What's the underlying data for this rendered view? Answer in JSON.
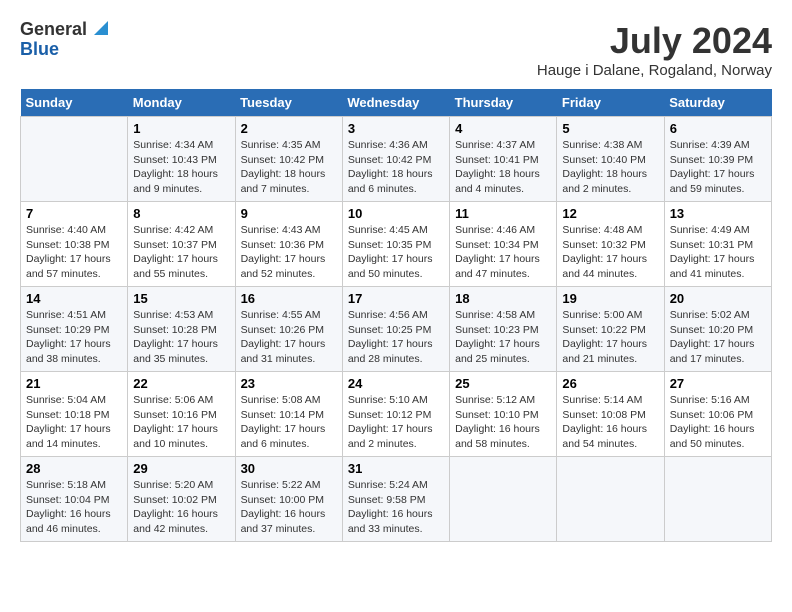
{
  "header": {
    "logo_general": "General",
    "logo_blue": "Blue",
    "title": "July 2024",
    "location": "Hauge i Dalane, Rogaland, Norway"
  },
  "calendar": {
    "days_of_week": [
      "Sunday",
      "Monday",
      "Tuesday",
      "Wednesday",
      "Thursday",
      "Friday",
      "Saturday"
    ],
    "weeks": [
      [
        {
          "day": "",
          "sunrise": "",
          "sunset": "",
          "daylight": ""
        },
        {
          "day": "1",
          "sunrise": "Sunrise: 4:34 AM",
          "sunset": "Sunset: 10:43 PM",
          "daylight": "Daylight: 18 hours and 9 minutes."
        },
        {
          "day": "2",
          "sunrise": "Sunrise: 4:35 AM",
          "sunset": "Sunset: 10:42 PM",
          "daylight": "Daylight: 18 hours and 7 minutes."
        },
        {
          "day": "3",
          "sunrise": "Sunrise: 4:36 AM",
          "sunset": "Sunset: 10:42 PM",
          "daylight": "Daylight: 18 hours and 6 minutes."
        },
        {
          "day": "4",
          "sunrise": "Sunrise: 4:37 AM",
          "sunset": "Sunset: 10:41 PM",
          "daylight": "Daylight: 18 hours and 4 minutes."
        },
        {
          "day": "5",
          "sunrise": "Sunrise: 4:38 AM",
          "sunset": "Sunset: 10:40 PM",
          "daylight": "Daylight: 18 hours and 2 minutes."
        },
        {
          "day": "6",
          "sunrise": "Sunrise: 4:39 AM",
          "sunset": "Sunset: 10:39 PM",
          "daylight": "Daylight: 17 hours and 59 minutes."
        }
      ],
      [
        {
          "day": "7",
          "sunrise": "Sunrise: 4:40 AM",
          "sunset": "Sunset: 10:38 PM",
          "daylight": "Daylight: 17 hours and 57 minutes."
        },
        {
          "day": "8",
          "sunrise": "Sunrise: 4:42 AM",
          "sunset": "Sunset: 10:37 PM",
          "daylight": "Daylight: 17 hours and 55 minutes."
        },
        {
          "day": "9",
          "sunrise": "Sunrise: 4:43 AM",
          "sunset": "Sunset: 10:36 PM",
          "daylight": "Daylight: 17 hours and 52 minutes."
        },
        {
          "day": "10",
          "sunrise": "Sunrise: 4:45 AM",
          "sunset": "Sunset: 10:35 PM",
          "daylight": "Daylight: 17 hours and 50 minutes."
        },
        {
          "day": "11",
          "sunrise": "Sunrise: 4:46 AM",
          "sunset": "Sunset: 10:34 PM",
          "daylight": "Daylight: 17 hours and 47 minutes."
        },
        {
          "day": "12",
          "sunrise": "Sunrise: 4:48 AM",
          "sunset": "Sunset: 10:32 PM",
          "daylight": "Daylight: 17 hours and 44 minutes."
        },
        {
          "day": "13",
          "sunrise": "Sunrise: 4:49 AM",
          "sunset": "Sunset: 10:31 PM",
          "daylight": "Daylight: 17 hours and 41 minutes."
        }
      ],
      [
        {
          "day": "14",
          "sunrise": "Sunrise: 4:51 AM",
          "sunset": "Sunset: 10:29 PM",
          "daylight": "Daylight: 17 hours and 38 minutes."
        },
        {
          "day": "15",
          "sunrise": "Sunrise: 4:53 AM",
          "sunset": "Sunset: 10:28 PM",
          "daylight": "Daylight: 17 hours and 35 minutes."
        },
        {
          "day": "16",
          "sunrise": "Sunrise: 4:55 AM",
          "sunset": "Sunset: 10:26 PM",
          "daylight": "Daylight: 17 hours and 31 minutes."
        },
        {
          "day": "17",
          "sunrise": "Sunrise: 4:56 AM",
          "sunset": "Sunset: 10:25 PM",
          "daylight": "Daylight: 17 hours and 28 minutes."
        },
        {
          "day": "18",
          "sunrise": "Sunrise: 4:58 AM",
          "sunset": "Sunset: 10:23 PM",
          "daylight": "Daylight: 17 hours and 25 minutes."
        },
        {
          "day": "19",
          "sunrise": "Sunrise: 5:00 AM",
          "sunset": "Sunset: 10:22 PM",
          "daylight": "Daylight: 17 hours and 21 minutes."
        },
        {
          "day": "20",
          "sunrise": "Sunrise: 5:02 AM",
          "sunset": "Sunset: 10:20 PM",
          "daylight": "Daylight: 17 hours and 17 minutes."
        }
      ],
      [
        {
          "day": "21",
          "sunrise": "Sunrise: 5:04 AM",
          "sunset": "Sunset: 10:18 PM",
          "daylight": "Daylight: 17 hours and 14 minutes."
        },
        {
          "day": "22",
          "sunrise": "Sunrise: 5:06 AM",
          "sunset": "Sunset: 10:16 PM",
          "daylight": "Daylight: 17 hours and 10 minutes."
        },
        {
          "day": "23",
          "sunrise": "Sunrise: 5:08 AM",
          "sunset": "Sunset: 10:14 PM",
          "daylight": "Daylight: 17 hours and 6 minutes."
        },
        {
          "day": "24",
          "sunrise": "Sunrise: 5:10 AM",
          "sunset": "Sunset: 10:12 PM",
          "daylight": "Daylight: 17 hours and 2 minutes."
        },
        {
          "day": "25",
          "sunrise": "Sunrise: 5:12 AM",
          "sunset": "Sunset: 10:10 PM",
          "daylight": "Daylight: 16 hours and 58 minutes."
        },
        {
          "day": "26",
          "sunrise": "Sunrise: 5:14 AM",
          "sunset": "Sunset: 10:08 PM",
          "daylight": "Daylight: 16 hours and 54 minutes."
        },
        {
          "day": "27",
          "sunrise": "Sunrise: 5:16 AM",
          "sunset": "Sunset: 10:06 PM",
          "daylight": "Daylight: 16 hours and 50 minutes."
        }
      ],
      [
        {
          "day": "28",
          "sunrise": "Sunrise: 5:18 AM",
          "sunset": "Sunset: 10:04 PM",
          "daylight": "Daylight: 16 hours and 46 minutes."
        },
        {
          "day": "29",
          "sunrise": "Sunrise: 5:20 AM",
          "sunset": "Sunset: 10:02 PM",
          "daylight": "Daylight: 16 hours and 42 minutes."
        },
        {
          "day": "30",
          "sunrise": "Sunrise: 5:22 AM",
          "sunset": "Sunset: 10:00 PM",
          "daylight": "Daylight: 16 hours and 37 minutes."
        },
        {
          "day": "31",
          "sunrise": "Sunrise: 5:24 AM",
          "sunset": "Sunset: 9:58 PM",
          "daylight": "Daylight: 16 hours and 33 minutes."
        },
        {
          "day": "",
          "sunrise": "",
          "sunset": "",
          "daylight": ""
        },
        {
          "day": "",
          "sunrise": "",
          "sunset": "",
          "daylight": ""
        },
        {
          "day": "",
          "sunrise": "",
          "sunset": "",
          "daylight": ""
        }
      ]
    ]
  }
}
